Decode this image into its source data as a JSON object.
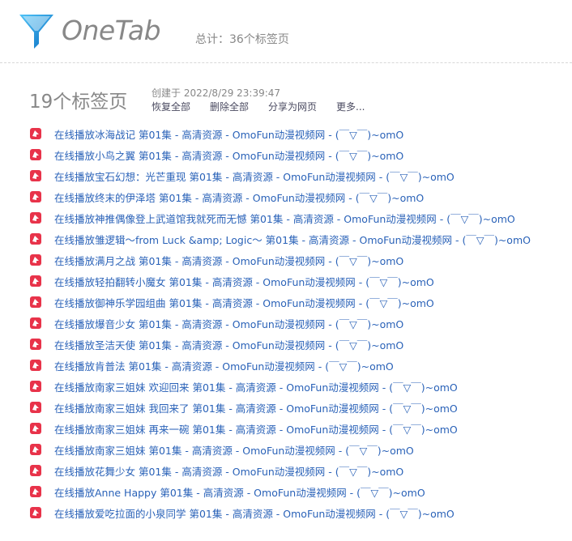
{
  "app": {
    "name": "OneTab",
    "total_label": "总计：36个标签页"
  },
  "group": {
    "count_label": "19个标签页",
    "created_label": "创建于 2022/8/29 23:39:47",
    "actions": {
      "restore_all": "恢复全部",
      "delete_all": "删除全部",
      "share": "分享为网页",
      "more": "更多..."
    },
    "colors": {
      "link": "#2a62b8",
      "favicon": "#e8334a"
    },
    "tabs": [
      {
        "title": "在线播放冰海战记 第01集 - 高清资源 - OmoFun动漫视频网 - (￣▽￣)~omO",
        "icon": "omofun-favicon"
      },
      {
        "title": "在线播放小鸟之翼 第01集 - 高清资源 - OmoFun动漫视频网 - (￣▽￣)~omO",
        "icon": "omofun-favicon"
      },
      {
        "title": "在线播放宝石幻想：光芒重现 第01集 - 高清资源 - OmoFun动漫视频网 - (￣▽￣)~omO",
        "icon": "omofun-favicon"
      },
      {
        "title": "在线播放终末的伊泽塔 第01集 - 高清资源 - OmoFun动漫视频网 - (￣▽￣)~omO",
        "icon": "omofun-favicon"
      },
      {
        "title": "在线播放神推偶像登上武道馆我就死而无憾 第01集 - 高清资源 - OmoFun动漫视频网 - (￣▽￣)~omO",
        "icon": "omofun-favicon"
      },
      {
        "title": "在线播放雏逻辑～from Luck &amp; Logic～ 第01集 - 高清资源 - OmoFun动漫视频网 - (￣▽￣)~omO",
        "icon": "omofun-favicon"
      },
      {
        "title": "在线播放满月之战 第01集 - 高清资源 - OmoFun动漫视频网 - (￣▽￣)~omO",
        "icon": "omofun-favicon"
      },
      {
        "title": "在线播放轻拍翻转小魔女 第01集 - 高清资源 - OmoFun动漫视频网 - (￣▽￣)~omO",
        "icon": "omofun-favicon"
      },
      {
        "title": "在线播放御神乐学园组曲 第01集 - 高清资源 - OmoFun动漫视频网 - (￣▽￣)~omO",
        "icon": "omofun-favicon"
      },
      {
        "title": "在线播放爆音少女 第01集 - 高清资源 - OmoFun动漫视频网 - (￣▽￣)~omO",
        "icon": "omofun-favicon"
      },
      {
        "title": "在线播放圣洁天使 第01集 - 高清资源 - OmoFun动漫视频网 - (￣▽￣)~omO",
        "icon": "omofun-favicon"
      },
      {
        "title": "在线播放肯普法 第01集 - 高清资源 - OmoFun动漫视频网 - (￣▽￣)~omO",
        "icon": "omofun-favicon"
      },
      {
        "title": "在线播放南家三姐妹 欢迎回来 第01集 - 高清资源 - OmoFun动漫视频网 - (￣▽￣)~omO",
        "icon": "omofun-favicon"
      },
      {
        "title": "在线播放南家三姐妹 我回来了 第01集 - 高清资源 - OmoFun动漫视频网 - (￣▽￣)~omO",
        "icon": "omofun-favicon"
      },
      {
        "title": "在线播放南家三姐妹 再来一碗 第01集 - 高清资源 - OmoFun动漫视频网 - (￣▽￣)~omO",
        "icon": "omofun-favicon"
      },
      {
        "title": "在线播放南家三姐妹 第01集 - 高清资源 - OmoFun动漫视频网 - (￣▽￣)~omO",
        "icon": "omofun-favicon"
      },
      {
        "title": "在线播放花舞少女 第01集 - 高清资源 - OmoFun动漫视频网 - (￣▽￣)~omO",
        "icon": "omofun-favicon"
      },
      {
        "title": "在线播放Anne Happy 第01集 - 高清资源 - OmoFun动漫视频网 - (￣▽￣)~omO",
        "icon": "omofun-favicon"
      },
      {
        "title": "在线播放爱吃拉面的小泉同学 第01集 - 高清资源 - OmoFun动漫视频网 - (￣▽￣)~omO",
        "icon": "omofun-favicon"
      }
    ]
  }
}
